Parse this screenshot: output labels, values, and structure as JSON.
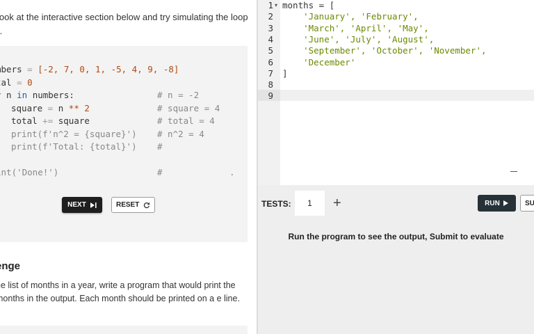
{
  "lesson": {
    "intro": "look at the interactive section below and try simulating the loop f.",
    "simulator": {
      "lines": [
        {
          "left": "mbers",
          "op": " = ",
          "list": "[-2, 7, 0, 1, -5, 4, 9, -8]"
        },
        {
          "left": "tal",
          "op": " = ",
          "num": "0"
        },
        {
          "kw": "r",
          "var": " n ",
          "in": "in",
          "rest": " numbers:"
        },
        {
          "indent": "square",
          "op": " = ",
          "rest": "n ",
          "pow": "**",
          "num": " 2"
        },
        {
          "indent": "total",
          "op": " += ",
          "rest": "square"
        },
        {
          "fn": "print(f'n^2 = {square}')"
        },
        {
          "fn": "print(f'Total: {total}')"
        },
        {
          "fn": "int('Done!')"
        }
      ],
      "comments": [
        "# n = -2",
        "# square = 4",
        "# total = 4",
        "# n^2 = 4",
        "#",
        "#"
      ],
      "trailing_dot": "."
    },
    "next_label": "NEXT",
    "reset_label": "RESET",
    "challenge_title": "enge",
    "challenge_text": "he list of months in a year, write a program that would print the months in the output. Each month should be printed on a e line."
  },
  "editor": {
    "line_numbers": [
      "1",
      "2",
      "3",
      "4",
      "5",
      "6",
      "7",
      "8",
      "9"
    ],
    "code": [
      {
        "plain": "months = ["
      },
      {
        "strs": "    'January', 'February',"
      },
      {
        "strs": "    'March', 'April', 'May',"
      },
      {
        "strs": "    'June', 'July', 'August',"
      },
      {
        "strs": "    'September', 'October', 'November',"
      },
      {
        "strs": "    'December'"
      },
      {
        "plain": "]"
      },
      {
        "plain": ""
      },
      {
        "plain": ""
      }
    ]
  },
  "run_panel": {
    "tests_label": "TESTS:",
    "tests_count": "1",
    "add_symbol": "+",
    "run_label": "RUN",
    "submit_label": "SU",
    "message": "Run the program to see the output, Submit to evaluate"
  },
  "colors": {
    "string_green": "#6a8a00",
    "run_button_bg": "#263238",
    "next_button_bg": "#1e1e1e",
    "panel_gray": "#eeeeee"
  }
}
